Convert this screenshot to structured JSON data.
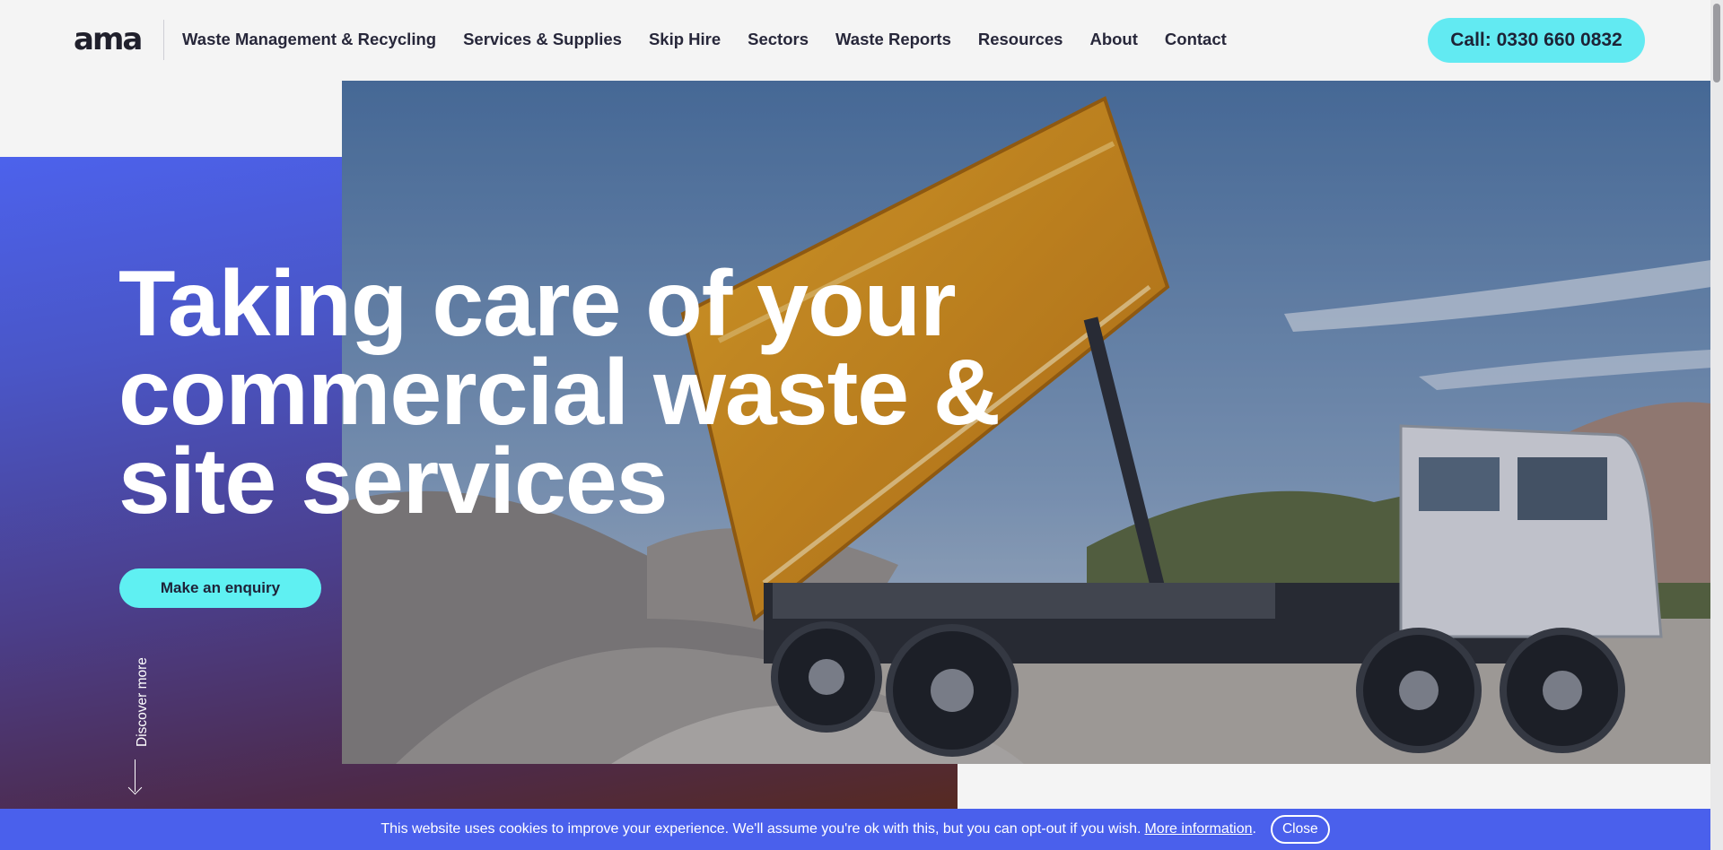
{
  "header": {
    "logo_text": "ama",
    "nav": [
      {
        "label": "Waste Management & Recycling"
      },
      {
        "label": "Services & Supplies"
      },
      {
        "label": "Skip Hire"
      },
      {
        "label": "Sectors"
      },
      {
        "label": "Waste Reports"
      },
      {
        "label": "Resources"
      },
      {
        "label": "About"
      },
      {
        "label": "Contact"
      }
    ],
    "call_label": "Call: 0330 660 0832"
  },
  "hero": {
    "title_line1": "Taking care of your",
    "title_line2": "commercial waste &",
    "title_line3": "site services",
    "enquiry_label": "Make an enquiry",
    "discover_label": "Discover more"
  },
  "cookie": {
    "message": "This website uses cookies to improve your experience. We'll assume you're ok with this, but you can opt-out if you wish.",
    "link_label": "More information",
    "suffix": ".",
    "close_label": "Close"
  },
  "colors": {
    "accent_cyan": "#5ff0f2",
    "brand_blue": "#4a60ec",
    "truck_orange": "#e49a18"
  },
  "icons": {
    "discover": "arrow-down-icon"
  }
}
